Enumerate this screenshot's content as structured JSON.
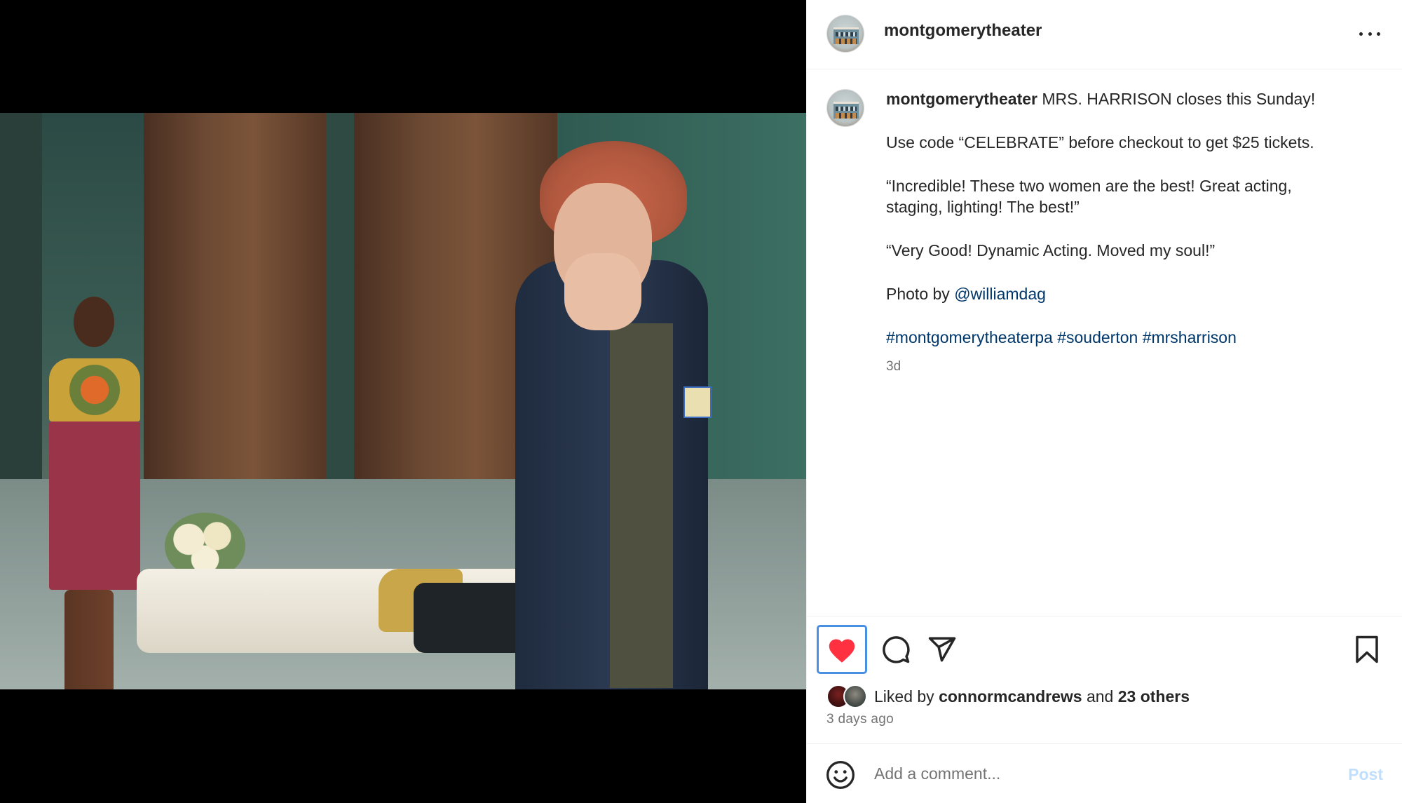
{
  "post": {
    "username": "montgomerytheater",
    "caption_user": "montgomerytheater",
    "caption_first": "MRS. HARRISON closes this Sunday!",
    "caption_code": "Use code “CELEBRATE” before checkout to get $25 tickets.",
    "caption_quote1_line1": "“Incredible! These two women are the best! Great acting,",
    "caption_quote1_line2": "staging, lighting! The best!”",
    "caption_quote2": "“Very Good! Dynamic Acting. Moved my soul!”",
    "photo_credit_prefix": "Photo by",
    "photo_credit_handle": "@williamdag",
    "hashtags": [
      "#montgomerytheaterpa",
      "#souderton",
      "#mrsharrison"
    ],
    "age": "3d"
  },
  "likes": {
    "prefix": "Liked by",
    "user": "connormcandrews",
    "and": "and",
    "others": "23 others",
    "timestamp": "3 days ago"
  },
  "comment": {
    "placeholder": "Add a comment...",
    "post_label": "Post"
  },
  "icons": {
    "like": "heart-filled-icon",
    "comment": "comment-bubble-icon",
    "share": "paper-plane-icon",
    "save": "bookmark-icon",
    "more": "more-horizontal-icon",
    "emoji": "emoji-smile-icon"
  },
  "colors": {
    "like_red": "#ff3040",
    "link_blue": "#00376b",
    "post_button_disabled": "#c0dffd",
    "focus_ring": "#4a90e2",
    "secondary_text": "#737373"
  }
}
